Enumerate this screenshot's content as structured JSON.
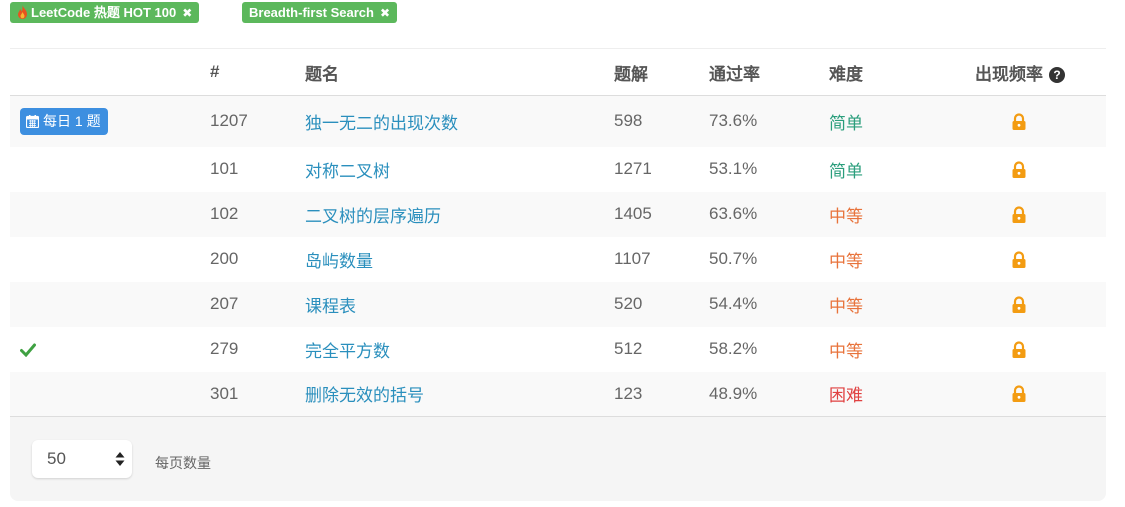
{
  "tags": [
    {
      "label": "LeetCode 热题 HOT 100",
      "close": "✖"
    },
    {
      "label": "Breadth-first Search",
      "close": "✖"
    }
  ],
  "table": {
    "headers": {
      "num": "#",
      "title": "题名",
      "solutions": "题解",
      "acceptance": "通过率",
      "difficulty": "难度",
      "frequency": "出现频率",
      "help": "?"
    },
    "daily_badge": "每日 1 题",
    "rows": [
      {
        "id": "1207",
        "title": "独一无二的出现次数",
        "solutions": "598",
        "acceptance": "73.6%",
        "difficulty": "简单",
        "level": "easy",
        "daily": true,
        "solved": false
      },
      {
        "id": "101",
        "title": "对称二叉树",
        "solutions": "1271",
        "acceptance": "53.1%",
        "difficulty": "简单",
        "level": "easy",
        "daily": false,
        "solved": false
      },
      {
        "id": "102",
        "title": "二叉树的层序遍历",
        "solutions": "1405",
        "acceptance": "63.6%",
        "difficulty": "中等",
        "level": "medium",
        "daily": false,
        "solved": false
      },
      {
        "id": "200",
        "title": "岛屿数量",
        "solutions": "1107",
        "acceptance": "50.7%",
        "difficulty": "中等",
        "level": "medium",
        "daily": false,
        "solved": false
      },
      {
        "id": "207",
        "title": "课程表",
        "solutions": "520",
        "acceptance": "54.4%",
        "difficulty": "中等",
        "level": "medium",
        "daily": false,
        "solved": false
      },
      {
        "id": "279",
        "title": "完全平方数",
        "solutions": "512",
        "acceptance": "58.2%",
        "difficulty": "中等",
        "level": "medium",
        "daily": false,
        "solved": true
      },
      {
        "id": "301",
        "title": "删除无效的括号",
        "solutions": "123",
        "acceptance": "48.9%",
        "difficulty": "困难",
        "level": "hard",
        "daily": false,
        "solved": false
      }
    ]
  },
  "pagination": {
    "page_size": "50",
    "label": "每页数量"
  },
  "colors": {
    "tag": "#5cb85c",
    "link": "#2a8fbd",
    "easy": "#2b9e7c",
    "medium": "#e8733b",
    "hard": "#e04141",
    "lock": "#f39c12",
    "daily": "#3d8fe0",
    "check": "#3fa142"
  }
}
